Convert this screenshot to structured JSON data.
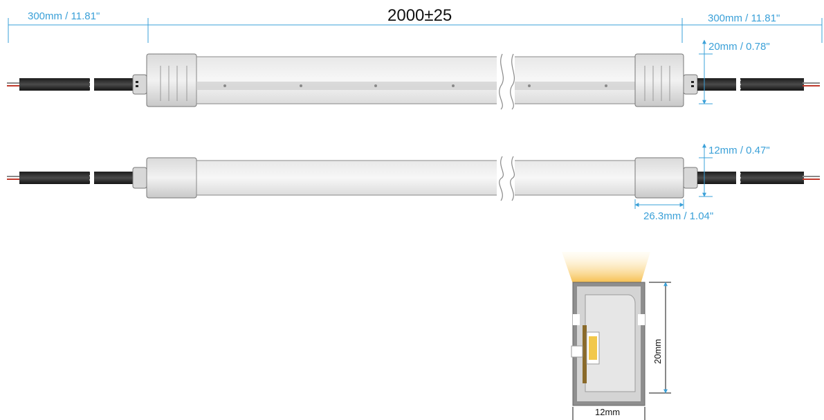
{
  "colors": {
    "dimension": "#3aa0d8",
    "cable": "#2a2a2a",
    "red_wire": "#c0392b",
    "glow": "#f7c660",
    "chip": "#f2c84b",
    "body": "#cfcfcf"
  },
  "dimensions": {
    "length_total": "2000±25",
    "cable_left": "300mm / 11.81\"",
    "cable_right": "300mm / 11.81\"",
    "height_top": "20mm / 0.78\"",
    "height_side": "12mm / 0.47\"",
    "endcap_length": "26.3mm / 1.04\"",
    "cross_height": "20mm",
    "cross_width": "12mm"
  }
}
